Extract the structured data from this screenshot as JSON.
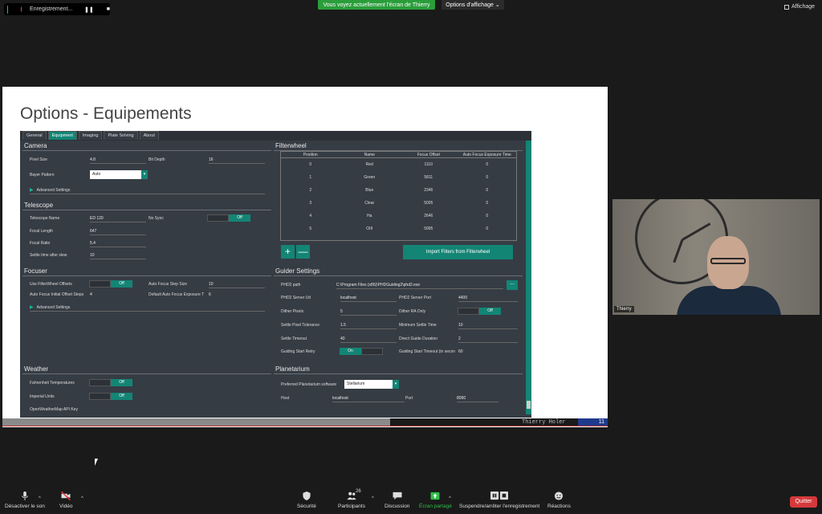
{
  "top": {
    "recording_label": "Enregistrement...",
    "pause_glyph": "❚❚",
    "stop_glyph": "■",
    "share_banner": "Vous voyez actuellement l'écran de Thierry",
    "share_options": "Options d'affichage",
    "view_label": "Affichage"
  },
  "slide": {
    "title": "Options - Equipements",
    "footer_name": "Thierry Holer",
    "page_number": "11"
  },
  "app": {
    "tabs": [
      "General",
      "Equipment",
      "Imaging",
      "Plate Solving",
      "About"
    ],
    "camera": {
      "title": "Camera",
      "pixel_size_label": "Pixel Size",
      "pixel_size": "4.8",
      "bit_depth_label": "Bit Depth",
      "bit_depth": "16",
      "bayer_label": "Bayer Pattern",
      "bayer": "Auto",
      "advanced": "Advanced Settings"
    },
    "telescope": {
      "title": "Telescope",
      "name_label": "Telescope Name",
      "name": "ED 120",
      "nosync_label": "No Sync",
      "nosync": "Off",
      "focal_length_label": "Focal Length",
      "focal_length": "647",
      "focal_ratio_label": "Focal Ratio",
      "focal_ratio": "5.4",
      "settle_label": "Settle time after slew",
      "settle": "10"
    },
    "focuser": {
      "title": "Focuser",
      "use_fw_label": "Use FilterWheel Offsets",
      "use_fw": "Off",
      "af_step_label": "Auto Focus Step Size",
      "af_step": "10",
      "af_initial_label": "Auto Focus Initial Offset Steps",
      "af_initial": "4",
      "af_exposure_label": "Default Auto Focus Exposure T",
      "af_exposure": "6",
      "advanced": "Advanced Settings"
    },
    "weather": {
      "title": "Weather",
      "fahrenheit_label": "Fahrenheit Temperatures",
      "fahrenheit": "Off",
      "imperial_label": "Imperial Units",
      "imperial": "Off",
      "owm_label": "OpenWeatherMap API Key"
    },
    "filterwheel": {
      "title": "Filterwheel",
      "headers": [
        "Position",
        "Name",
        "Focus Offset",
        "Auto Focus Exposure Time"
      ],
      "rows": [
        [
          "0",
          "Red",
          "1110",
          "0"
        ],
        [
          "1",
          "Green",
          "5811",
          "0"
        ],
        [
          "2",
          "Blue",
          "2346",
          "0"
        ],
        [
          "3",
          "Clear",
          "5005",
          "0"
        ],
        [
          "4",
          "Ha",
          "2646",
          "0"
        ],
        [
          "5",
          "OIII",
          "5995",
          "0"
        ]
      ],
      "add": "+",
      "remove": "—",
      "import": "Import Filters from Filterwheel"
    },
    "guider": {
      "title": "Guider Settings",
      "path_label": "PHD2 path",
      "path": "C:\\Program Files (x86)\\PHDGuiding2\\phd2.exe",
      "dots": "...",
      "url_label": "PHD2 Server Url",
      "url": "localhost",
      "port_label": "PHD2 Server Port",
      "port": "4400",
      "dither_label": "Dither Pixels",
      "dither": "5",
      "ra_only_label": "Dither RA Only",
      "ra_only": "Off",
      "tolerance_label": "Settle Pixel Tolerance",
      "tolerance": "1.5",
      "min_settle_label": "Minimum Settle Time",
      "min_settle": "10",
      "timeout_label": "Settle Timeout",
      "timeout": "40",
      "direct_label": "Direct Guide Duration",
      "direct": "2",
      "retry_label": "Guiding Start Retry",
      "retry": "On",
      "start_timeout_label": "Guiding Start Timeout (in secon",
      "start_timeout": "60"
    },
    "planetarium": {
      "title": "Planetarium",
      "software_label": "Preferred Planetarium software",
      "software": "Stellarium",
      "host_label": "Host",
      "host": "localhost",
      "port_label": "Port",
      "port": "8090"
    }
  },
  "video": {
    "name": "Thierry"
  },
  "toolbar": {
    "mute": "Désactiver le son",
    "video": "Vidéo",
    "security": "Sécurité",
    "participants": "Participants",
    "participants_count": "26",
    "discussion": "Discussion",
    "share": "Écran partagé",
    "recording": "Suspendre/arrêter l'enregistrement",
    "reactions": "Réactions",
    "quit": "Quitter",
    "caret": "^"
  },
  "colors": {
    "accent": "#138575",
    "share_green": "#2a9d3a",
    "quit_red": "#d6393b",
    "panel_bg": "#363c44"
  }
}
